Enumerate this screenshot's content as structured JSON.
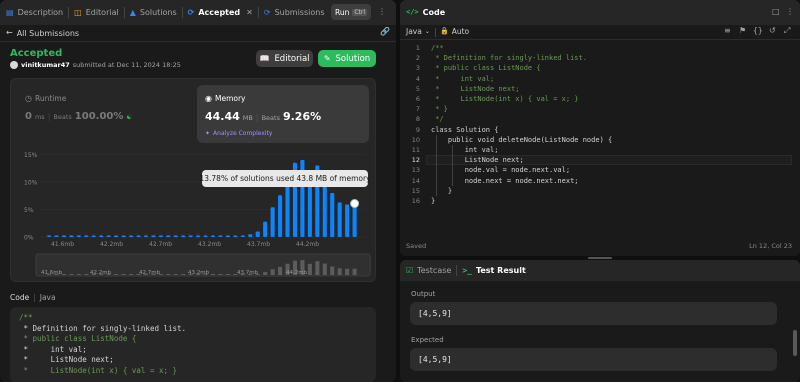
{
  "left_tabs": {
    "description": "Description",
    "editorial": "Editorial",
    "solutions": "Solutions",
    "accepted": "Accepted",
    "submissions": "Submissions"
  },
  "run": {
    "label": "Run",
    "shortcut": "Ctrl"
  },
  "back": {
    "label": "All Submissions"
  },
  "result": {
    "status": "Accepted",
    "user": "vinitkumar47",
    "submitted_text": "submitted at Dec 11, 2024 18:25",
    "status_color": "#2cbb5d"
  },
  "buttons": {
    "editorial": "Editorial",
    "solution": "Solution"
  },
  "runtime": {
    "label": "Runtime",
    "value": "0",
    "unit": "ms",
    "beats_label": "Beats",
    "beats_value": "100.00%"
  },
  "memory": {
    "label": "Memory",
    "value": "44.44",
    "unit": "MB",
    "beats_label": "Beats",
    "beats_value": "9.26%",
    "analyze": "Analyze Complexity"
  },
  "tooltip": {
    "text": "13.78% of solutions used 43.8 MB of memory"
  },
  "chart_data": {
    "type": "bar",
    "yticks": [
      "15%",
      "10%",
      "5%",
      "0%"
    ],
    "xticks": [
      "41.6mb",
      "42.2mb",
      "42.7mb",
      "43.2mb",
      "43.7mb",
      "44.2mb"
    ],
    "ylim": [
      0,
      16
    ],
    "values": [
      0.3,
      0.3,
      0.3,
      0.3,
      0.3,
      0.3,
      0.3,
      0.3,
      0.3,
      0.3,
      0.3,
      0.3,
      0.3,
      0.3,
      0.3,
      0.3,
      0.3,
      0.3,
      0.3,
      0.3,
      0.3,
      0.3,
      0.3,
      0.3,
      0.3,
      0.3,
      0.3,
      0.5,
      1.0,
      2.8,
      5.4,
      7.6,
      10.6,
      13.5,
      14.0,
      10.5,
      13.0,
      10.8,
      8.0,
      6.3,
      5.9,
      5.9
    ],
    "highlight_index": 41,
    "bar_color": "#0a84ff",
    "mini_xticks": [
      "41.6mb",
      "42.2mb",
      "42.7mb",
      "43.2mb",
      "43.7mb",
      "44.2mb"
    ]
  },
  "code_section": {
    "label": "Code",
    "language": "Java"
  },
  "bottom_code": [
    "/**",
    " * Definition for singly-linked list.",
    " * public class ListNode {",
    " *     int val;",
    " *     ListNode next;",
    " *     ListNode(int x) { val = x; }"
  ],
  "editor": {
    "title": "Code",
    "language": "Java",
    "mode": "Auto",
    "saved": "Saved",
    "position": "Ln 12, Col 23",
    "current_line": 12,
    "line_numbers": [
      "1",
      "2",
      "3",
      "4",
      "5",
      "6",
      "7",
      "8",
      "9",
      "10",
      "11",
      "12",
      "13",
      "14",
      "15",
      "16"
    ],
    "lines": [
      "/**",
      " * Definition for singly-linked list.",
      " * public class ListNode {",
      " *     int val;",
      " *     ListNode next;",
      " *     ListNode(int x) { val = x; }",
      " * }",
      " */",
      "class Solution {",
      "    public void deleteNode(ListNode node) {",
      "        int val;",
      "        ListNode next;",
      "        node.val = node.next.val;",
      "        node.next = node.next.next;",
      "    }",
      "}"
    ]
  },
  "testcase": {
    "tab_testcase": "Testcase",
    "tab_result": "Test Result",
    "output_label": "Output",
    "output_value": "[4,5,9]",
    "expected_label": "Expected",
    "expected_value": "[4,5,9]"
  }
}
